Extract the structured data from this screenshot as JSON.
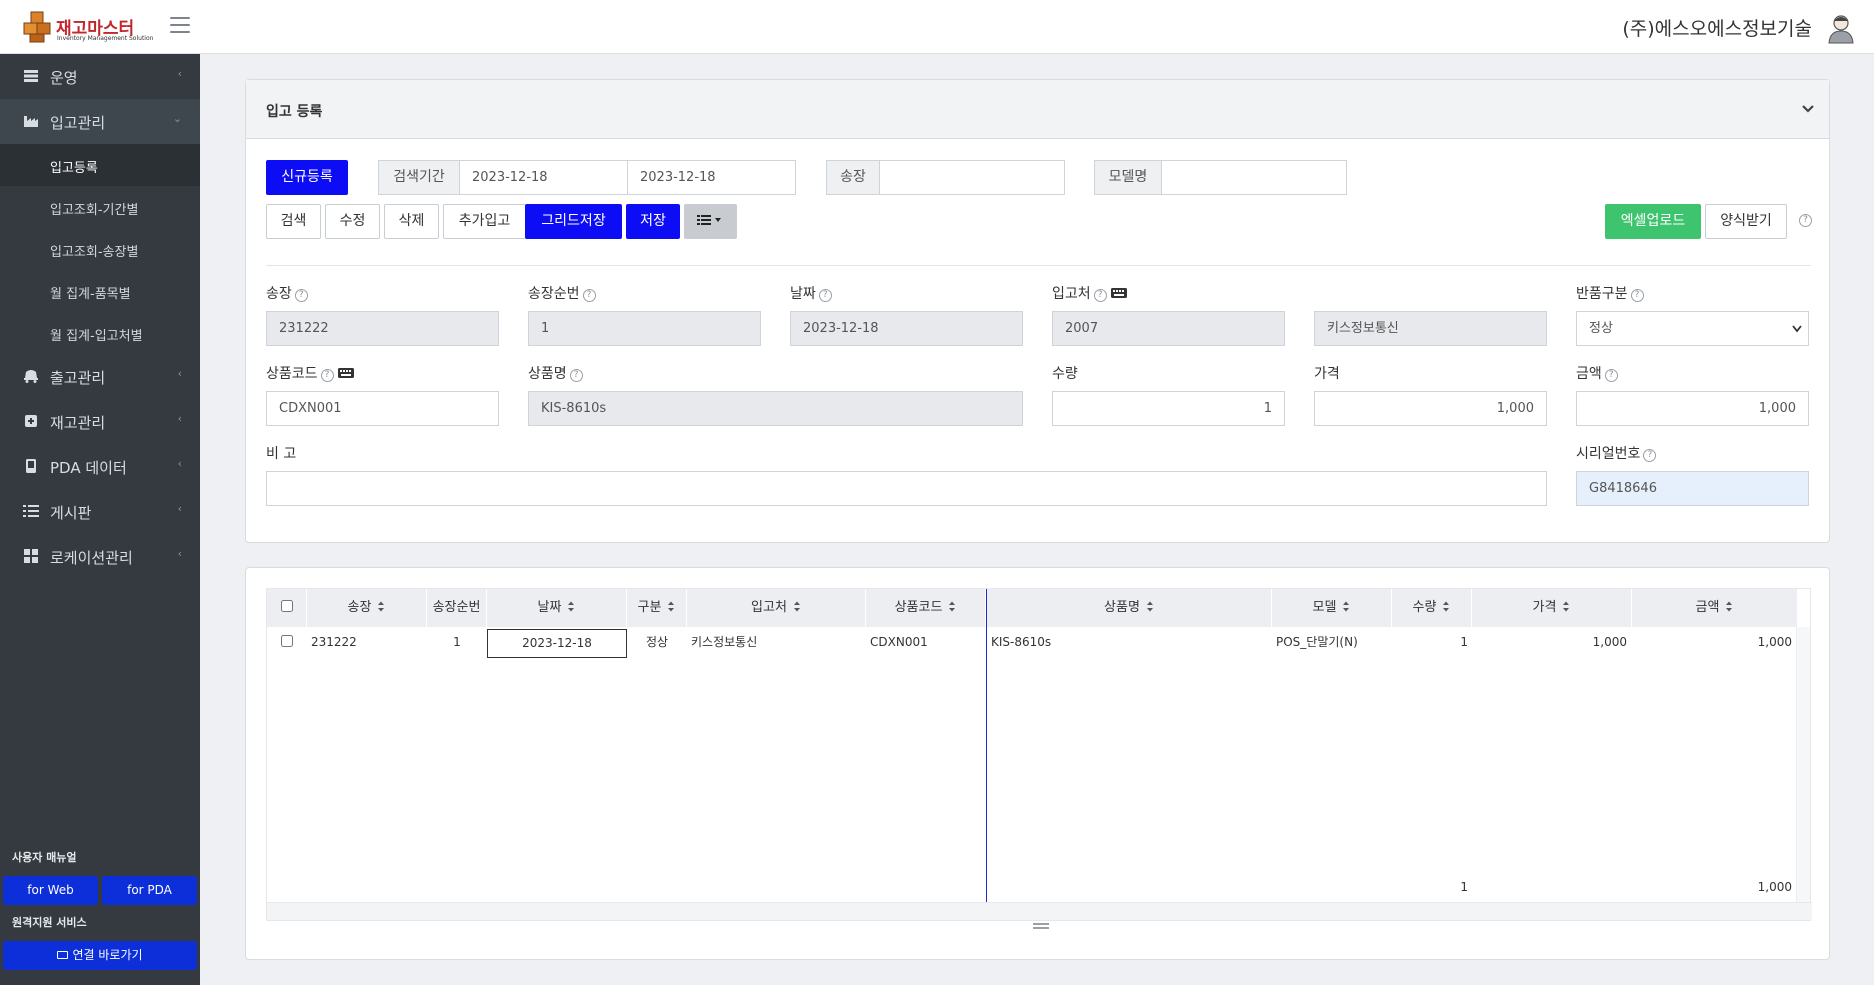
{
  "app": {
    "logo_title": "재고마스터",
    "logo_subtitle": "Inventory Management Solution",
    "company": "(주)에스오에스정보기술"
  },
  "sidebar": {
    "items": [
      {
        "label": "운영",
        "icon": "database-icon"
      },
      {
        "label": "입고관리",
        "icon": "factory-icon"
      },
      {
        "label": "출고관리",
        "icon": "truck-icon"
      },
      {
        "label": "재고관리",
        "icon": "box-icon"
      },
      {
        "label": "PDA 데이터",
        "icon": "device-icon"
      },
      {
        "label": "게시판",
        "icon": "list-icon"
      },
      {
        "label": "로케이션관리",
        "icon": "grid-icon"
      }
    ],
    "subitems": [
      "입고등록",
      "입고조회-기간별",
      "입고조회-송장별",
      "월 집계-품목별",
      "월 집계-입고처별"
    ],
    "manual_caption": "사용자 매뉴얼",
    "for_web": "for Web",
    "for_pda": "for PDA",
    "remote_caption": "원격지원 서비스",
    "connect": "연결 바로가기"
  },
  "form": {
    "title": "입고 등록",
    "new_button": "신규등록",
    "search_period_label": "검색기간",
    "date_from": "2023-12-18",
    "date_to": "2023-12-18",
    "invoice_label": "송장",
    "invoice_search": "",
    "model_label": "모델명",
    "model_search": "",
    "buttons": {
      "search": "검색",
      "edit": "수정",
      "delete": "삭제",
      "add_receive": "추가입고",
      "grid_save": "그리드저장",
      "save": "저장",
      "excel_upload": "엑셀업로드",
      "template": "양식받기"
    },
    "fields": {
      "invoice": {
        "label": "송장",
        "value": "231222"
      },
      "invoice_seq": {
        "label": "송장순번",
        "value": "1"
      },
      "date": {
        "label": "날짜",
        "value": "2023-12-18"
      },
      "supplier": {
        "label": "입고처",
        "code": "2007",
        "name": "키스정보통신"
      },
      "return_type": {
        "label": "반품구분",
        "value": "정상"
      },
      "product_code": {
        "label": "상품코드",
        "value": "CDXN001"
      },
      "product_name": {
        "label": "상품명",
        "value": "KIS-8610s"
      },
      "quantity": {
        "label": "수량",
        "value": "1"
      },
      "price": {
        "label": "가격",
        "value": "1,000"
      },
      "amount": {
        "label": "금액",
        "value": "1,000"
      },
      "remarks": {
        "label": "비 고",
        "value": ""
      },
      "serial": {
        "label": "시리얼번호",
        "value": "G8418646"
      }
    }
  },
  "grid": {
    "headers": [
      "송장",
      "송장순번",
      "날짜",
      "구분",
      "입고처",
      "상품코드",
      "상품명",
      "모델",
      "수량",
      "가격",
      "금액"
    ],
    "rows": [
      {
        "invoice": "231222",
        "seq": "1",
        "date": "2023-12-18",
        "type": "정상",
        "supplier": "키스정보통신",
        "code": "CDXN001",
        "name": "KIS-8610s",
        "model": "POS_단말기(N)",
        "qty": "1",
        "price": "1,000",
        "amount": "1,000"
      }
    ],
    "footer": {
      "qty_total": "1",
      "amount_total": "1,000"
    }
  },
  "colors": {
    "sidebar": "#343a40",
    "primary_blue": "#0d0df5",
    "green": "#3ec46e",
    "brand_red": "#c1272d"
  }
}
